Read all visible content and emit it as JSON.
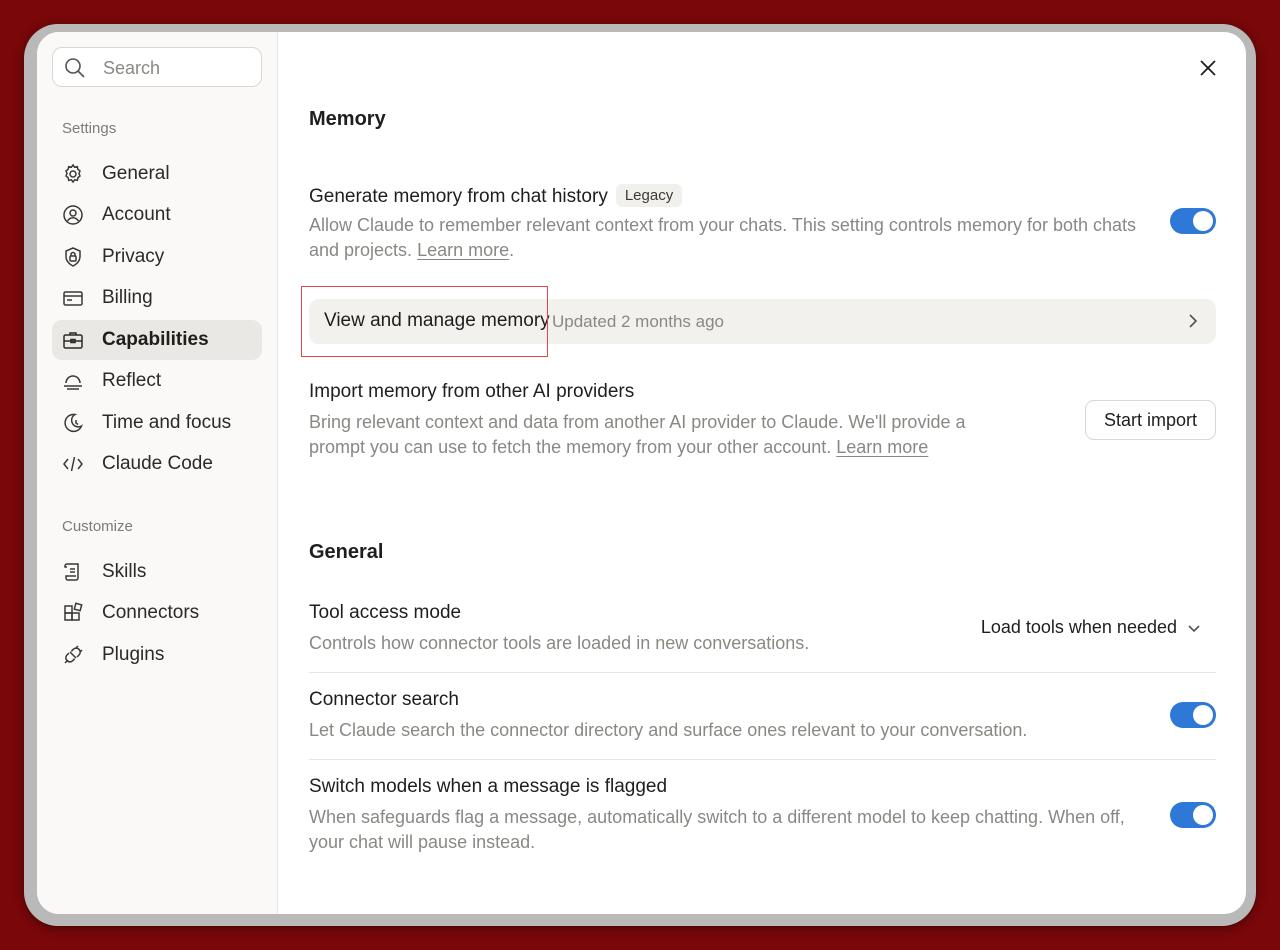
{
  "search": {
    "placeholder": "Search"
  },
  "sidebar": {
    "settings_label": "Settings",
    "items": [
      {
        "label": "General",
        "icon": "gear-icon"
      },
      {
        "label": "Account",
        "icon": "user-circle-icon"
      },
      {
        "label": "Privacy",
        "icon": "shield-lock-icon"
      },
      {
        "label": "Billing",
        "icon": "credit-card-icon"
      },
      {
        "label": "Capabilities",
        "icon": "briefcase-icon",
        "active": true
      },
      {
        "label": "Reflect",
        "icon": "sunrise-icon"
      },
      {
        "label": "Time and focus",
        "icon": "moon-clock-icon"
      },
      {
        "label": "Claude Code",
        "icon": "code-icon"
      }
    ],
    "customize_label": "Customize",
    "customize_items": [
      {
        "label": "Skills",
        "icon": "scroll-icon"
      },
      {
        "label": "Connectors",
        "icon": "blocks-icon"
      },
      {
        "label": "Plugins",
        "icon": "plug-icon"
      }
    ]
  },
  "memory": {
    "heading": "Memory",
    "generate": {
      "title": "Generate memory from chat history",
      "badge": "Legacy",
      "desc": "Allow Claude to remember relevant context from your chats. This setting controls memory for both chats and projects.",
      "link": "Learn more",
      "enabled": true
    },
    "manage": {
      "title": "View and manage memory",
      "meta": "Updated 2 months ago"
    },
    "import": {
      "title": "Import memory from other AI providers",
      "desc": "Bring relevant context and data from another AI provider to Claude. We'll provide a prompt you can use to fetch the memory from your other account.",
      "link": "Learn more",
      "button": "Start import"
    }
  },
  "general": {
    "heading": "General",
    "tool_access": {
      "title": "Tool access mode",
      "desc": "Controls how connector tools are loaded in new conversations.",
      "value": "Load tools when needed"
    },
    "connector_search": {
      "title": "Connector search",
      "desc": "Let Claude search the connector directory and surface ones relevant to your conversation.",
      "enabled": true
    },
    "switch_models": {
      "title": "Switch models when a message is flagged",
      "desc": "When safeguards flag a message, automatically switch to a different model to keep chatting. When off, your chat will pause instead.",
      "enabled": true
    }
  },
  "colors": {
    "accent": "#2e78d8",
    "background": "#7a070a",
    "highlight": "#e0464c"
  }
}
